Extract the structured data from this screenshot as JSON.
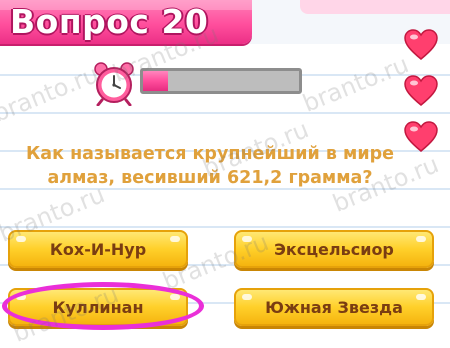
{
  "header": {
    "title": "Вопрос 20"
  },
  "lives": {
    "count": 3,
    "icon": "heart-icon",
    "color": "#ff3f6e"
  },
  "timer": {
    "icon": "alarm-clock-icon",
    "progress": 0.16,
    "fill_color": "#ff4d9c"
  },
  "question": {
    "line1": "Как называется крупнейший в мире",
    "line2": "алмаз, весивший 621,2 грамма?"
  },
  "answers": [
    {
      "label": "Кох-И-Нур"
    },
    {
      "label": "Эксцельсиор"
    },
    {
      "label": "Куллинан",
      "highlighted": true
    },
    {
      "label": "Южная Звезда"
    }
  ],
  "watermark": "branto.ru"
}
